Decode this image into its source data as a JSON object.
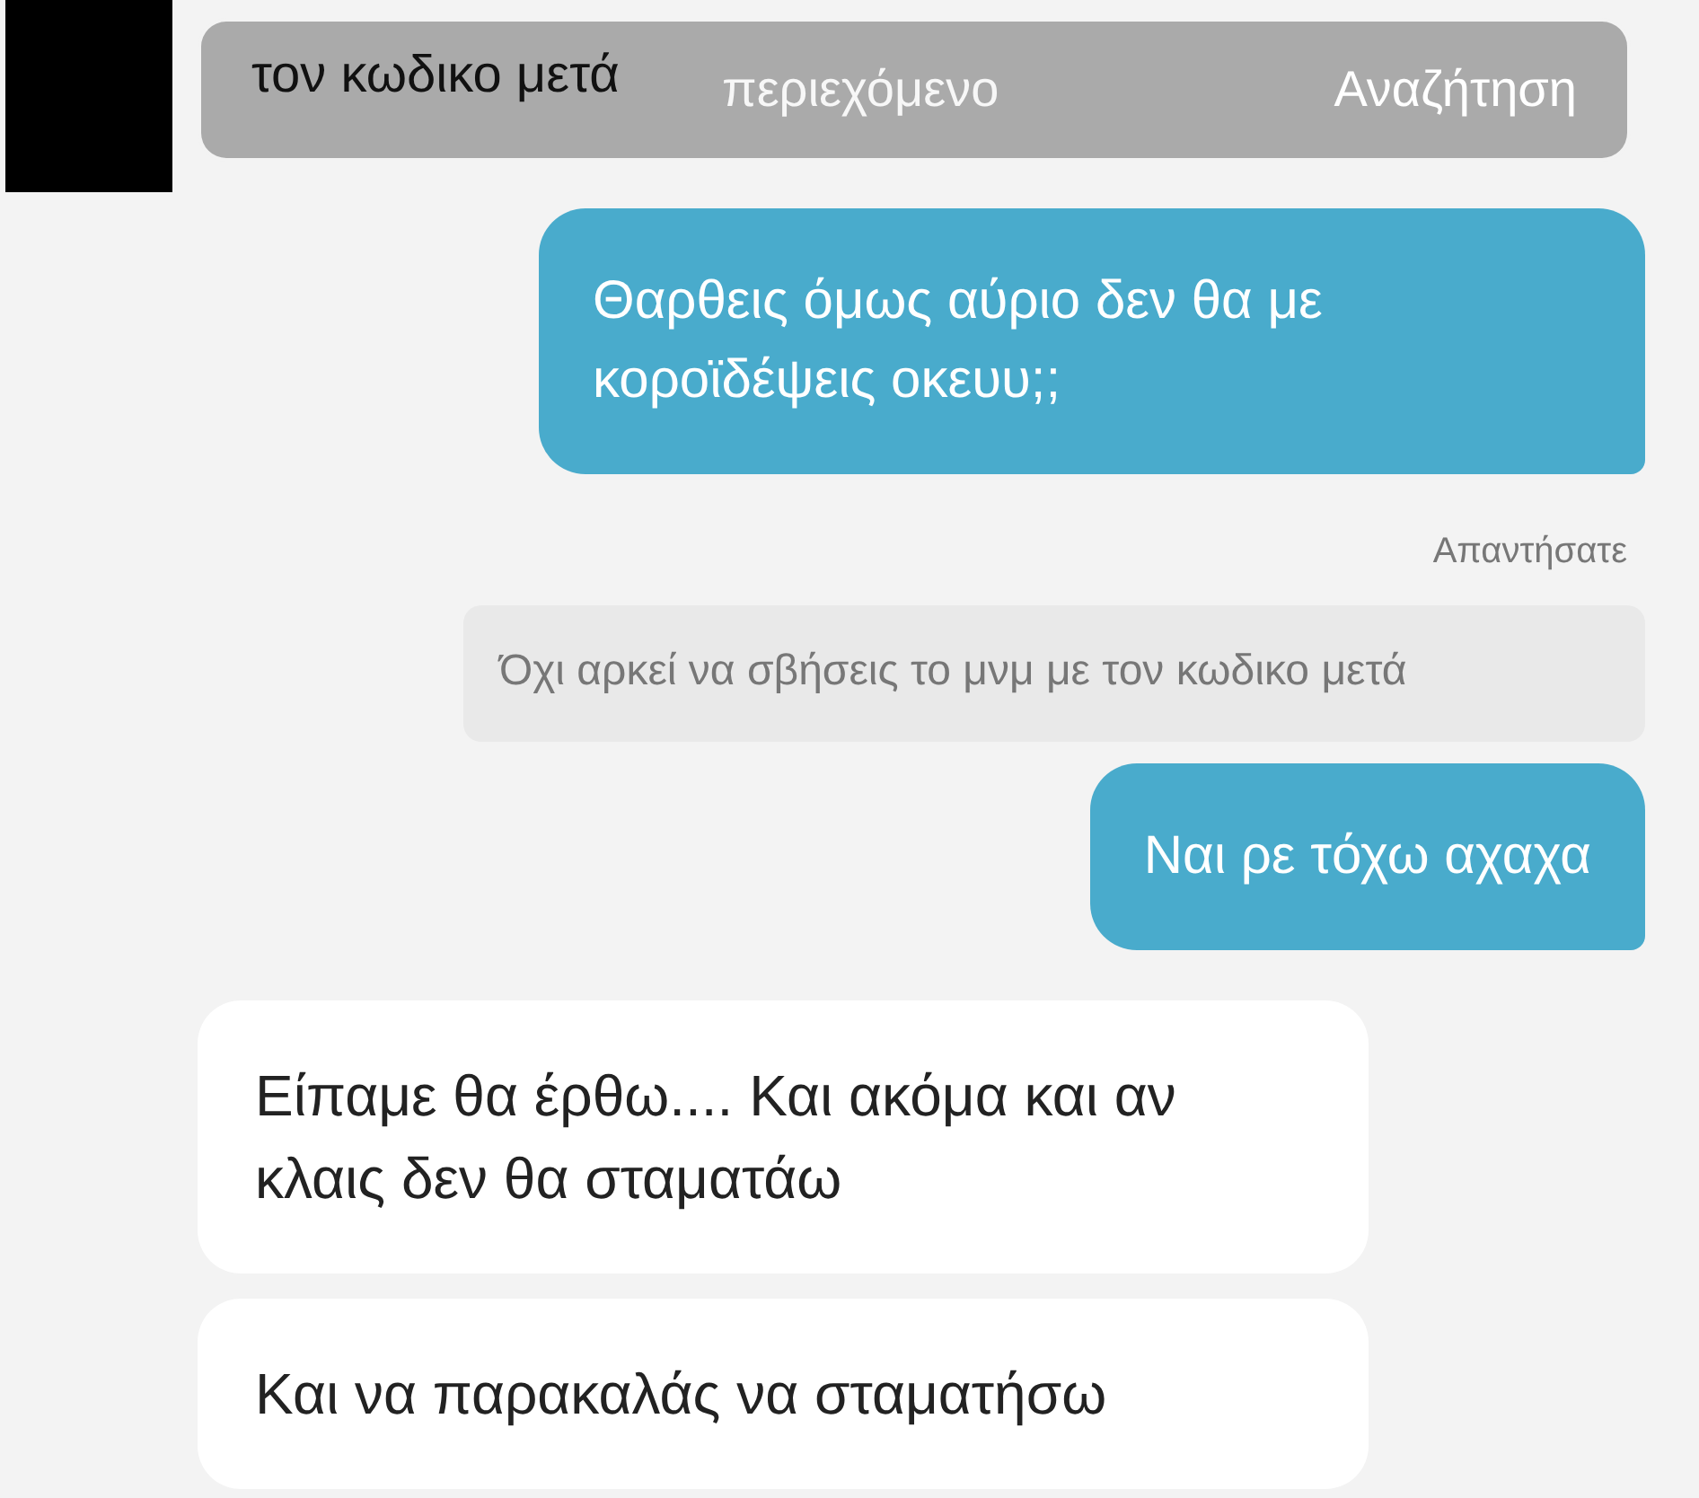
{
  "top_message": {
    "text": "τον κωδικο μετά"
  },
  "search": {
    "placeholder": "περιεχόμενο",
    "button": "Αναζήτηση"
  },
  "messages": [
    {
      "kind": "sent",
      "text": "Θαρθεις όμως αύριο δεν θα με κοροϊδέψεις οκευυ;;"
    },
    {
      "kind": "reply_label",
      "text": "Απαντήσατε"
    },
    {
      "kind": "quote",
      "text": "Όχι αρκεί να σβήσεις το μνμ με τον κωδικο μετά"
    },
    {
      "kind": "sent",
      "text": "Ναι ρε τόχω αχαχα"
    },
    {
      "kind": "received",
      "text": "Είπαμε θα έρθω.... Και ακόμα και αν κλαις δεν θα σταματάω"
    },
    {
      "kind": "received",
      "text": "Και να παρακαλάς να σταματήσω"
    }
  ]
}
